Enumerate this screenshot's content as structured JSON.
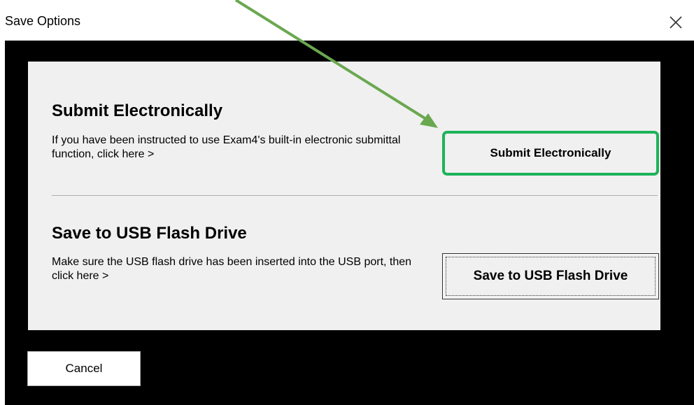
{
  "window": {
    "title": "Save Options",
    "close_icon": "close-icon"
  },
  "submit_section": {
    "heading": "Submit Electronically",
    "description": "If you have been instructed to use Exam4's built-in electronic submittal function, click here >",
    "button_label": "Submit Electronically",
    "highlight_color": "#1db35a"
  },
  "usb_section": {
    "heading": "Save to USB Flash Drive",
    "description": "Make sure the USB flash drive has been inserted into the USB port, then click here >",
    "button_label": "Save to USB Flash Drive"
  },
  "footer": {
    "cancel_label": "Cancel"
  },
  "annotation": {
    "arrow_icon": "arrow-icon",
    "arrow_color": "#6aa84f"
  }
}
